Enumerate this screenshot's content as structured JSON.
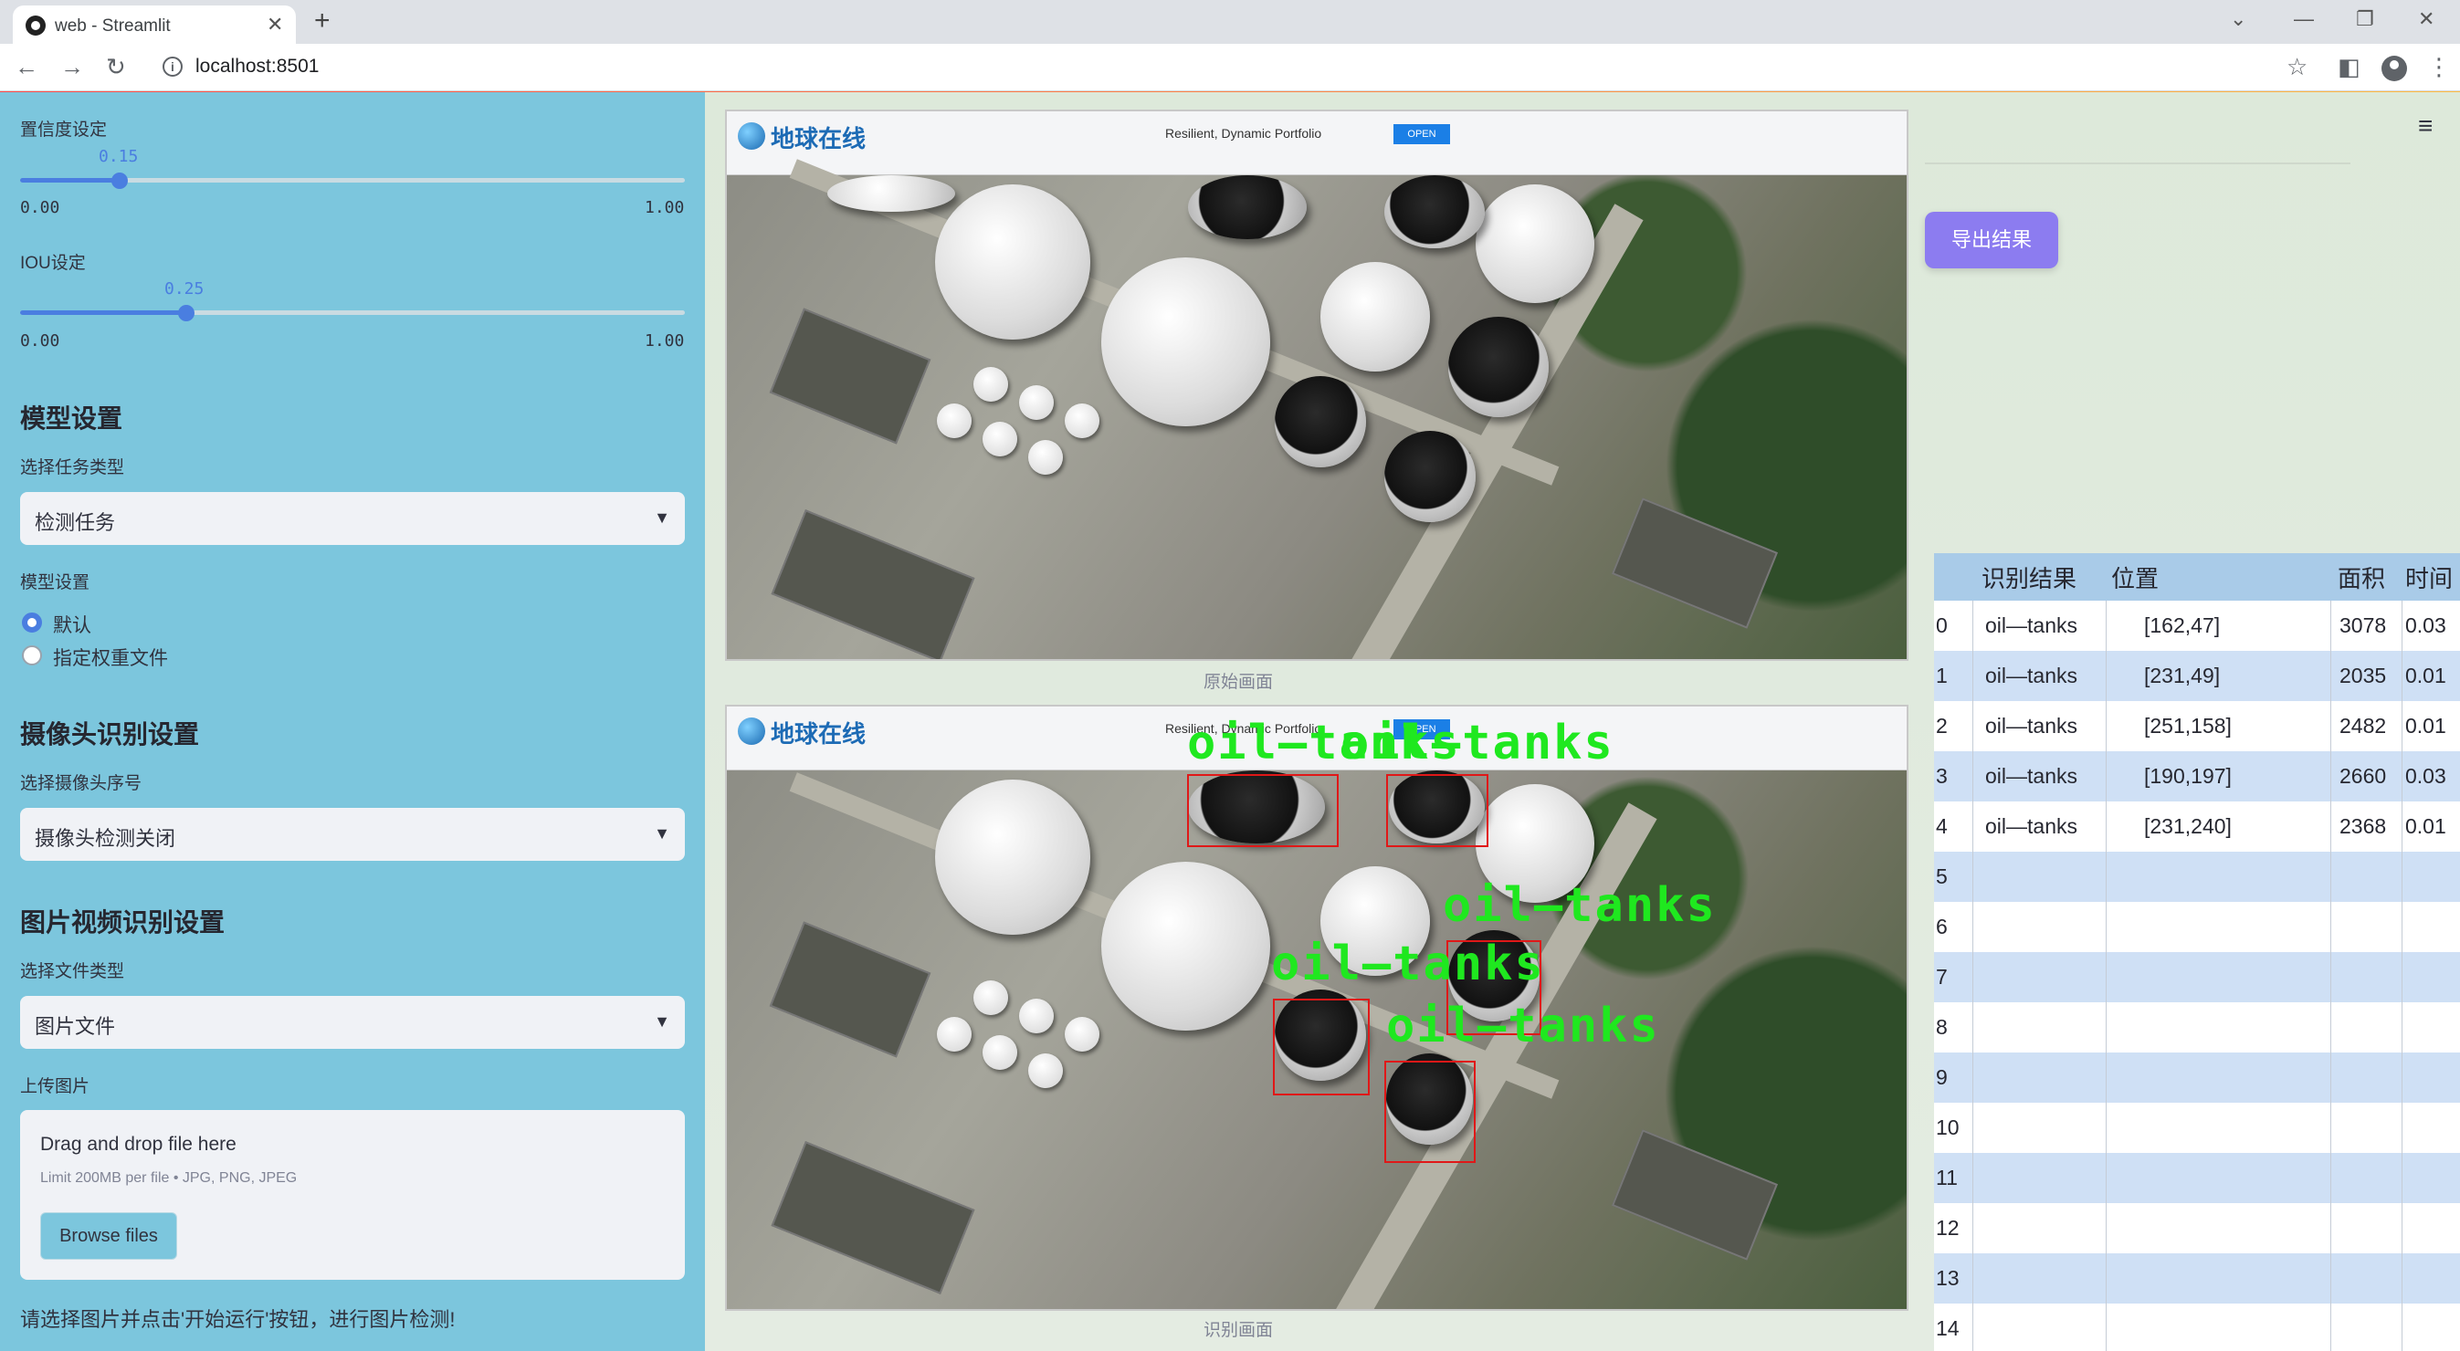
{
  "browser": {
    "tab_title": "web - Streamlit",
    "url": "localhost:8501"
  },
  "sidebar": {
    "conf_label": "置信度设定",
    "conf_value": "0.15",
    "conf_fraction": 0.15,
    "conf_min": "0.00",
    "conf_max": "1.00",
    "iou_label": "IOU设定",
    "iou_value": "0.25",
    "iou_fraction": 0.25,
    "iou_min": "0.00",
    "iou_max": "1.00",
    "model_heading": "模型设置",
    "task_label": "选择任务类型",
    "task_value": "检测任务",
    "model_label": "模型设置",
    "radio_default": "默认",
    "radio_custom": "指定权重文件",
    "camera_heading": "摄像头识别设置",
    "camera_label": "选择摄像头序号",
    "camera_value": "摄像头检测关闭",
    "media_heading": "图片视频识别设置",
    "filetype_label": "选择文件类型",
    "filetype_value": "图片文件",
    "upload_label": "上传图片",
    "upload_title": "Drag and drop file here",
    "upload_limit": "Limit 200MB per file • JPG, PNG, JPEG",
    "browse_label": "Browse files",
    "hint": "请选择图片并点击'开始运行'按钮，进行图片检测!"
  },
  "main": {
    "original_caption": "原始画面",
    "result_caption": "识别画面",
    "export_label": "导出结果",
    "fake_logo": "地球在线",
    "fake_ad": "Resilient, Dynamic Portfolio",
    "fake_open": "OPEN",
    "detection_label": "oil—tanks"
  },
  "table": {
    "headers": [
      "识别结果",
      "位置",
      "面积",
      "时间"
    ],
    "rows": [
      {
        "idx": "0",
        "result": "oil—tanks",
        "pos": "[162,47]",
        "area": "3078",
        "time": "0.03"
      },
      {
        "idx": "1",
        "result": "oil—tanks",
        "pos": "[231,49]",
        "area": "2035",
        "time": "0.01"
      },
      {
        "idx": "2",
        "result": "oil—tanks",
        "pos": "[251,158]",
        "area": "2482",
        "time": "0.01"
      },
      {
        "idx": "3",
        "result": "oil—tanks",
        "pos": "[190,197]",
        "area": "2660",
        "time": "0.03"
      },
      {
        "idx": "4",
        "result": "oil—tanks",
        "pos": "[231,240]",
        "area": "2368",
        "time": "0.01"
      },
      {
        "idx": "5",
        "result": "",
        "pos": "",
        "area": "",
        "time": ""
      },
      {
        "idx": "6",
        "result": "",
        "pos": "",
        "area": "",
        "time": ""
      },
      {
        "idx": "7",
        "result": "",
        "pos": "",
        "area": "",
        "time": ""
      },
      {
        "idx": "8",
        "result": "",
        "pos": "",
        "area": "",
        "time": ""
      },
      {
        "idx": "9",
        "result": "",
        "pos": "",
        "area": "",
        "time": ""
      },
      {
        "idx": "10",
        "result": "",
        "pos": "",
        "area": "",
        "time": ""
      },
      {
        "idx": "11",
        "result": "",
        "pos": "",
        "area": "",
        "time": ""
      },
      {
        "idx": "12",
        "result": "",
        "pos": "",
        "area": "",
        "time": ""
      },
      {
        "idx": "13",
        "result": "",
        "pos": "",
        "area": "",
        "time": ""
      },
      {
        "idx": "14",
        "result": "",
        "pos": "",
        "area": "",
        "time": ""
      }
    ]
  },
  "colors": {
    "sidebar_bg": "#7cc6dd",
    "accent": "#4a7ee0",
    "export_button": "#8c7cf0",
    "detection_box": "#e01818",
    "detection_text": "#1fe81f"
  }
}
